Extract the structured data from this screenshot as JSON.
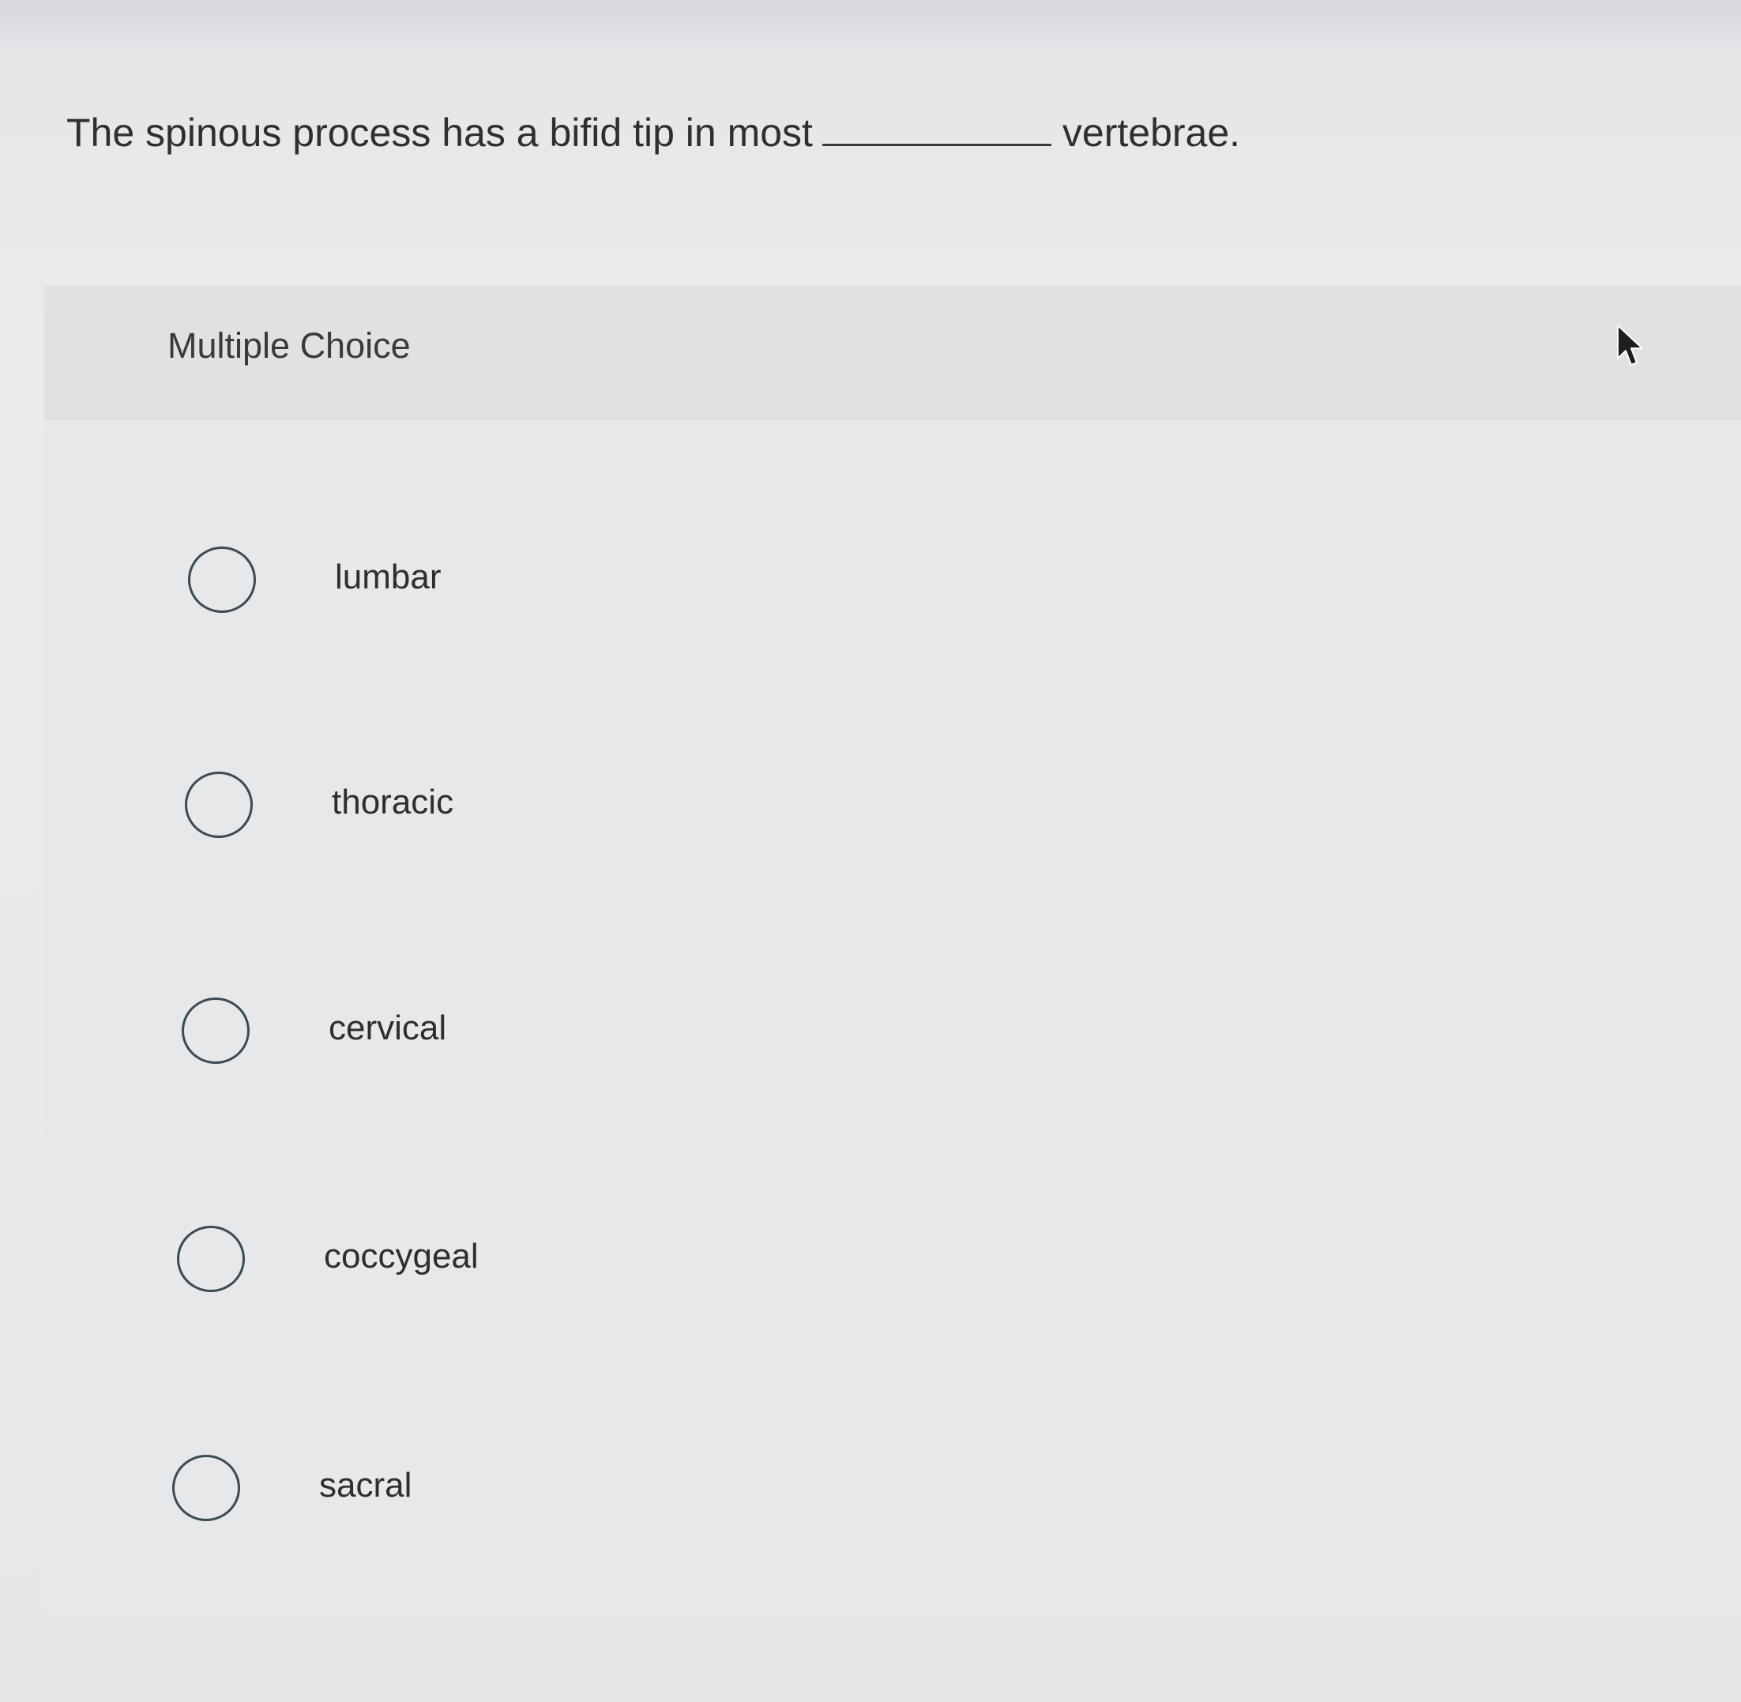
{
  "question": {
    "before_blank": "The spinous process has a bifid tip in most",
    "after_blank": "vertebrae."
  },
  "multiple_choice": {
    "label": "Multiple Choice",
    "options": [
      {
        "label": "lumbar",
        "selected": false
      },
      {
        "label": "thoracic",
        "selected": false
      },
      {
        "label": "cervical",
        "selected": false
      },
      {
        "label": "coccygeal",
        "selected": false
      },
      {
        "label": "sacral",
        "selected": false
      }
    ]
  },
  "icons": {
    "cursor": "mouse-pointer-icon",
    "radio": "radio-button-icon"
  },
  "colors": {
    "radio_border": "#3d4a52",
    "text": "#2e2e2e"
  }
}
